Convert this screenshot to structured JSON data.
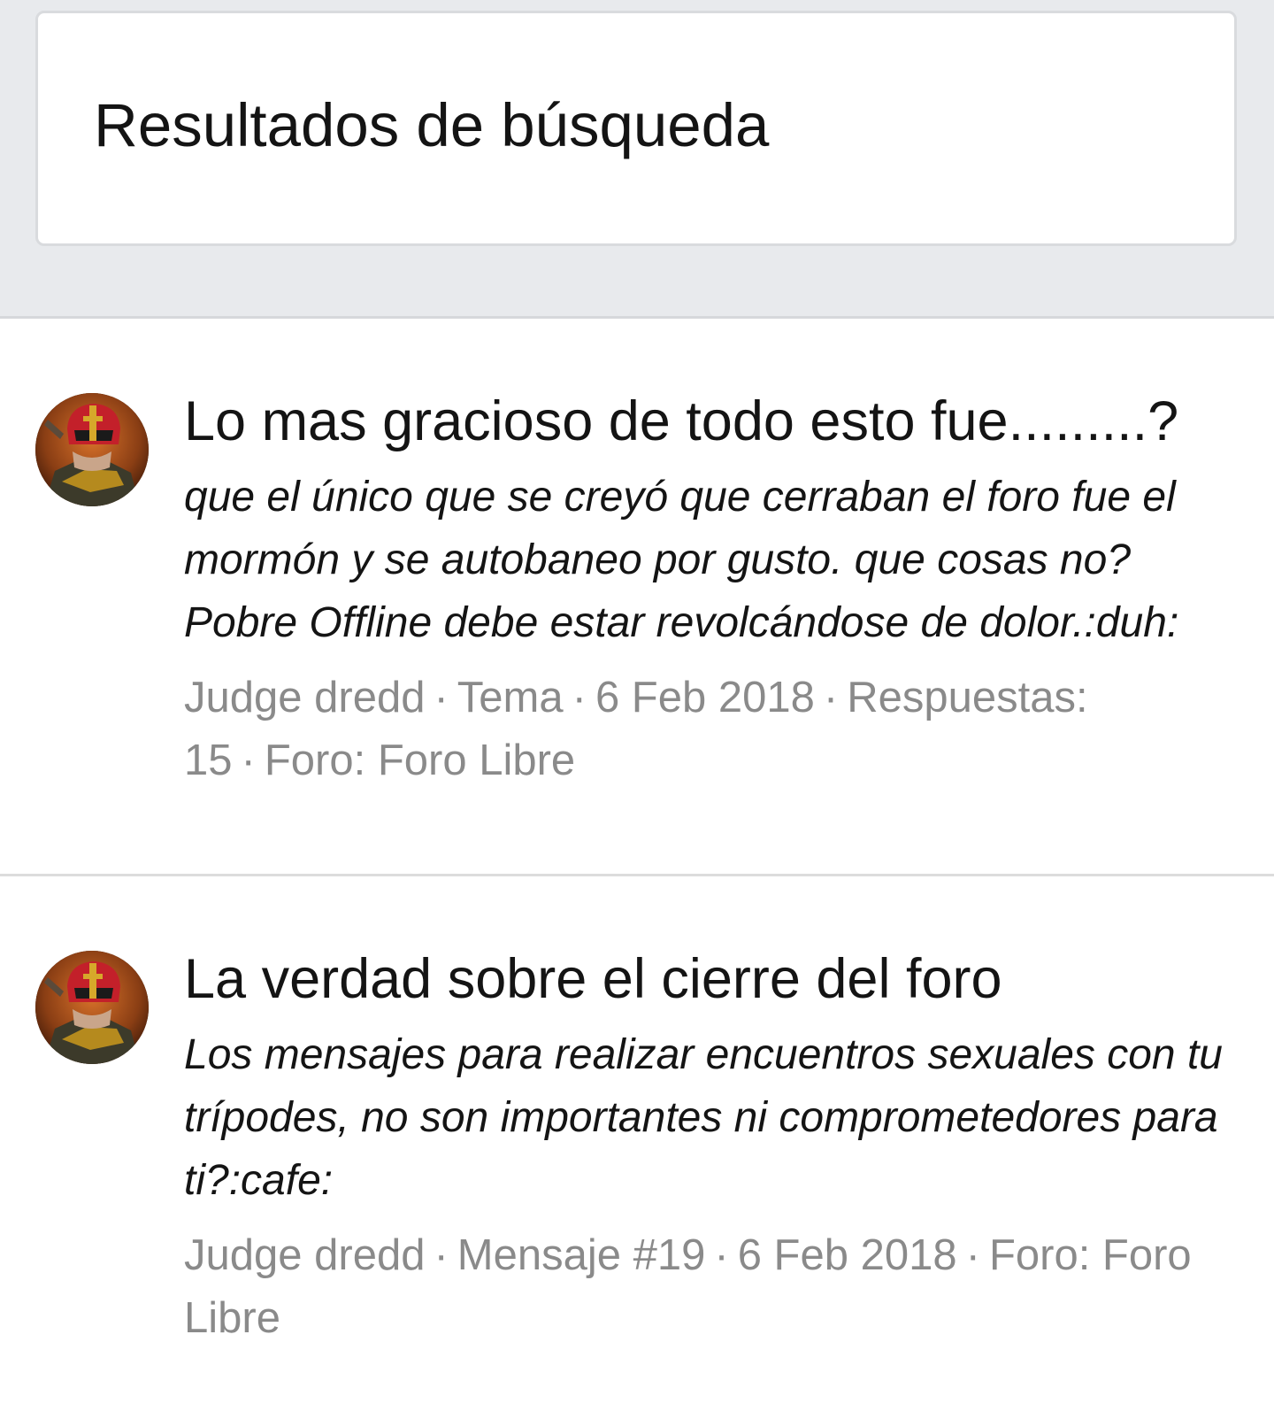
{
  "header": {
    "title": "Resultados de búsqueda"
  },
  "results": [
    {
      "title": "Lo mas gracioso de todo esto fue.........?",
      "snippet": "que el único que se creyó que cerraban el foro fue el mormón y se autobaneo por gusto. que cosas no? Pobre Offline debe estar revolcándose de dolor.:duh:",
      "author": "Judge dredd",
      "type": "Tema",
      "date": "6 Feb 2018",
      "replies": "Respuestas: 15",
      "forum": "Foro: Foro Libre",
      "avatar_icon": "judge-helmet-avatar"
    },
    {
      "title": "La verdad sobre el cierre del foro",
      "snippet": "Los mensajes para realizar encuentros sexuales con tu trípodes, no son importantes ni comprometedores para ti?:cafe:",
      "author": "Judge dredd",
      "type": "Mensaje #19",
      "date": "6 Feb 2018",
      "forum": "Foro: Foro Libre",
      "avatar_icon": "judge-helmet-avatar"
    }
  ],
  "colors": {
    "page_background": "#e8eaed",
    "card_background": "#ffffff",
    "text_primary": "#141414",
    "text_meta": "#8a8a8a",
    "divider": "#dcdcdc"
  }
}
